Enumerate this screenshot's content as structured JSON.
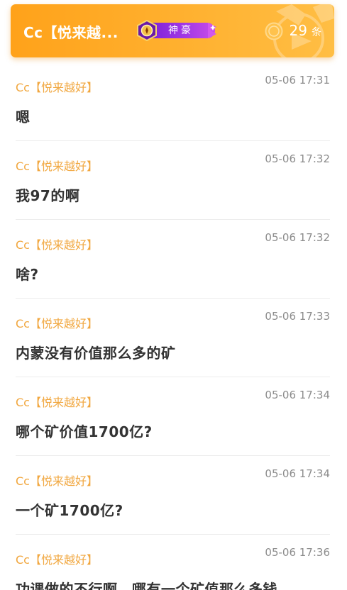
{
  "header": {
    "name": "Cc【悦来越...",
    "badge_label": "神豪",
    "badge_icon": "rank-emblem-icon",
    "count": "29",
    "count_unit": "条",
    "count_icon": "coin-icon",
    "colors": {
      "header_bg": "#ffab25",
      "badge_bg": "#9b35e0",
      "sender": "#f1a73f",
      "time": "#8c8c8c",
      "text": "#333333"
    }
  },
  "messages": [
    {
      "sender": "Cc【悦来越好】",
      "time": "05-06 17:31",
      "text": "嗯"
    },
    {
      "sender": "Cc【悦来越好】",
      "time": "05-06 17:32",
      "text": "我97的啊"
    },
    {
      "sender": "Cc【悦来越好】",
      "time": "05-06 17:32",
      "text": "啥?"
    },
    {
      "sender": "Cc【悦来越好】",
      "time": "05-06 17:33",
      "text": "内蒙没有价值那么多的矿"
    },
    {
      "sender": "Cc【悦来越好】",
      "time": "05-06 17:34",
      "text": "哪个矿价值1700亿?"
    },
    {
      "sender": "Cc【悦来越好】",
      "time": "05-06 17:34",
      "text": "一个矿1700亿?"
    },
    {
      "sender": "Cc【悦来越好】",
      "time": "05-06 17:36",
      "text": "功课做的不行啊，哪有一个矿值那么多钱"
    }
  ]
}
